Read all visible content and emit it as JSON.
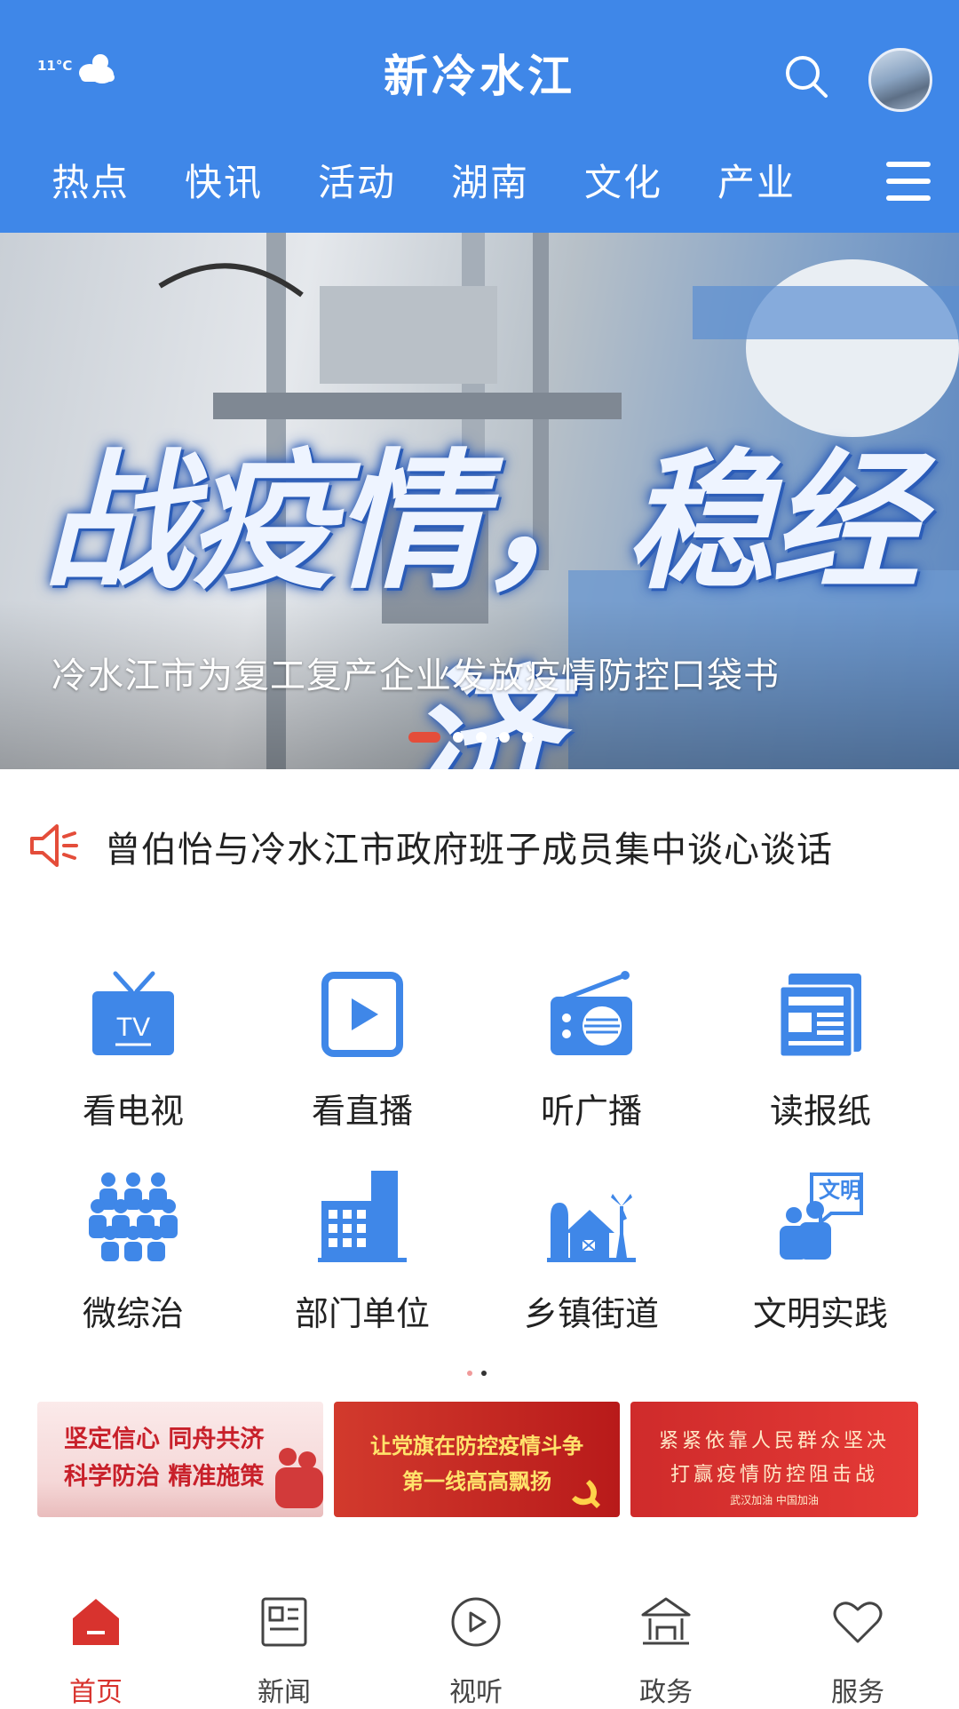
{
  "header": {
    "weather": {
      "temp": "11°C",
      "icon": "cloud-icon"
    },
    "title": "新冷水江",
    "tabs": [
      "热点",
      "快讯",
      "活动",
      "湖南",
      "文化",
      "产业"
    ],
    "colors": {
      "primary": "#3f87e8"
    }
  },
  "banner": {
    "overlay_text": "战疫情，稳经济",
    "caption": "冷水江市为复工复产企业发放疫情防控口袋书",
    "slides_count": 5,
    "active_slide": 1
  },
  "ticker": {
    "text": "曾伯怡与冷水江市政府班子成员集中谈心谈话"
  },
  "grid": [
    {
      "label": "看电视",
      "icon": "tv-icon"
    },
    {
      "label": "看直播",
      "icon": "play-icon"
    },
    {
      "label": "听广播",
      "icon": "radio-icon"
    },
    {
      "label": "读报纸",
      "icon": "newspaper-icon"
    },
    {
      "label": "微综治",
      "icon": "group-icon"
    },
    {
      "label": "部门单位",
      "icon": "building-icon"
    },
    {
      "label": "乡镇街道",
      "icon": "village-icon"
    },
    {
      "label": "文明实践",
      "icon": "civilization-icon",
      "badge": "文明"
    }
  ],
  "promos": [
    {
      "line1": "坚定信心 同舟共济",
      "line2": "科学防治 精准施策"
    },
    {
      "line1": "让党旗在防控疫情斗争",
      "line2": "第一线高高飘扬"
    },
    {
      "line1": "紧紧依靠人民群众坚决",
      "line2": "打赢疫情防控阻击战",
      "line3": "武汉加油 中国加油"
    }
  ],
  "bottom_nav": [
    {
      "label": "首页",
      "icon": "home-icon",
      "active": true
    },
    {
      "label": "新闻",
      "icon": "news-icon"
    },
    {
      "label": "视听",
      "icon": "play-circle-icon"
    },
    {
      "label": "政务",
      "icon": "government-icon"
    },
    {
      "label": "服务",
      "icon": "heart-icon"
    }
  ]
}
